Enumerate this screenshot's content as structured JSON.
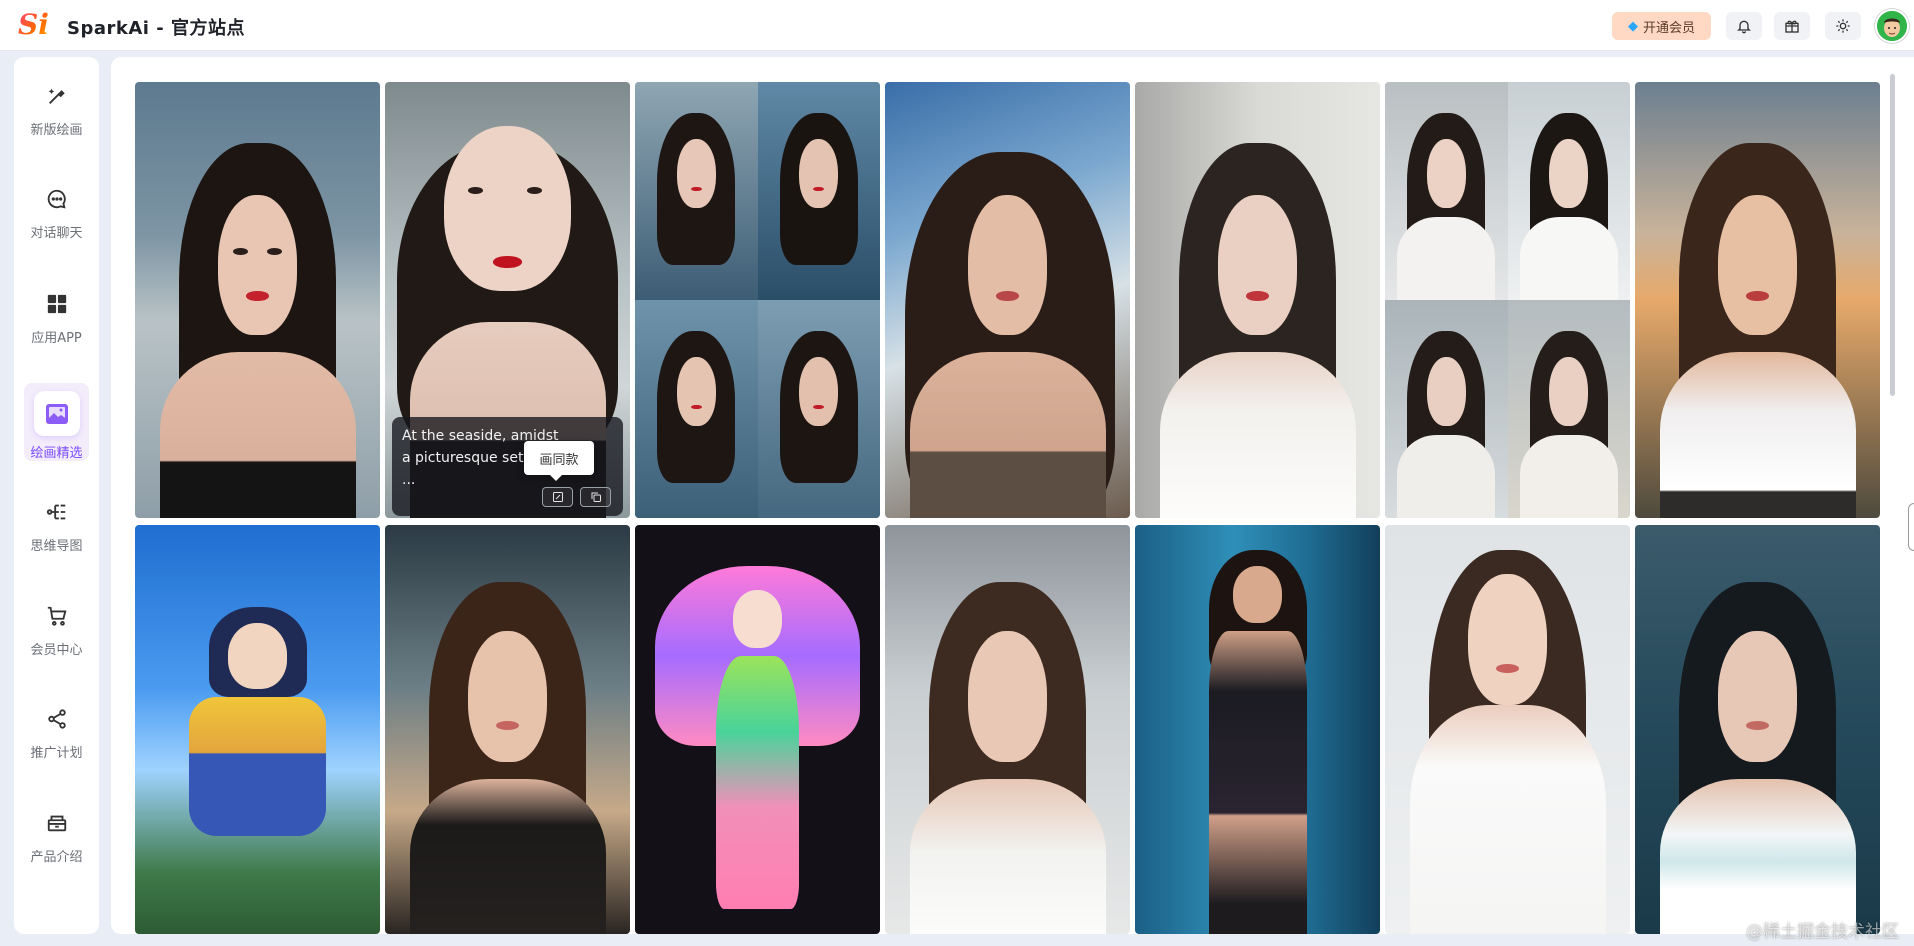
{
  "header": {
    "logo_text": "Si",
    "title": "SparkAi - 官方站点",
    "vip_label": "开通会员",
    "icons": [
      "bell-icon",
      "gift-icon",
      "sun-icon"
    ]
  },
  "sidebar": {
    "items": [
      {
        "label": "新版绘画",
        "icon": "magic-brush-icon"
      },
      {
        "label": "对话聊天",
        "icon": "chat-bubble-icon"
      },
      {
        "label": "应用APP",
        "icon": "grid-apps-icon"
      },
      {
        "label": "绘画精选",
        "icon": "picture-icon",
        "active": true
      },
      {
        "label": "思维导图",
        "icon": "mindmap-icon"
      },
      {
        "label": "会员中心",
        "icon": "cart-icon"
      },
      {
        "label": "推广计划",
        "icon": "share-icon"
      },
      {
        "label": "产品介绍",
        "icon": "product-icon"
      }
    ]
  },
  "gallery": {
    "hover_prompt": "At the seaside, amidst a picturesque setting, ...",
    "tooltip_label": "画同款",
    "hover_buttons": [
      "draw-same-icon",
      "copy-icon"
    ]
  },
  "watermark": "@稀土掘金技术社区",
  "colors": {
    "accent": "#7c4dff",
    "vip_bg": "#ffd9c4",
    "page_bg": "#e9edf5"
  }
}
